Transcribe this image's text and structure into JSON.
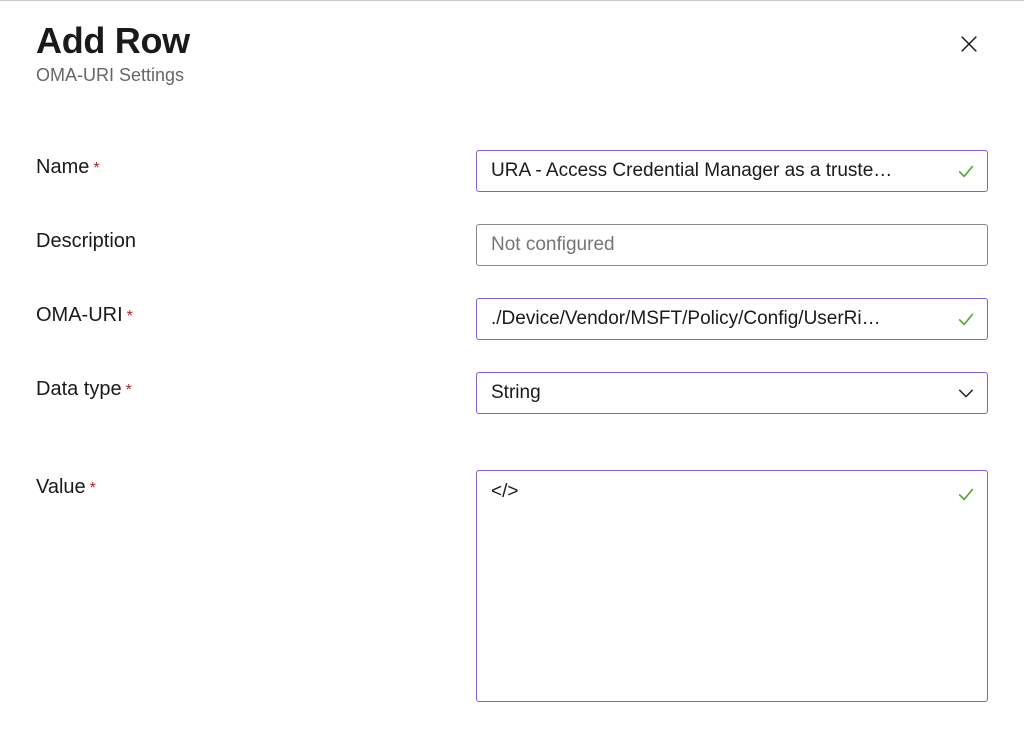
{
  "header": {
    "title": "Add Row",
    "subtitle": "OMA-URI Settings"
  },
  "form": {
    "name": {
      "label": "Name",
      "required": true,
      "value": "URA - Access Credential Manager as a truste…",
      "validated": true
    },
    "description": {
      "label": "Description",
      "required": false,
      "value": "",
      "placeholder": "Not configured",
      "validated": false
    },
    "omauri": {
      "label": "OMA-URI",
      "required": true,
      "value": "./Device/Vendor/MSFT/Policy/Config/UserRi…",
      "validated": true
    },
    "datatype": {
      "label": "Data type",
      "required": true,
      "selected": "String"
    },
    "value": {
      "label": "Value",
      "required": true,
      "content": "</>",
      "validated": true
    }
  }
}
